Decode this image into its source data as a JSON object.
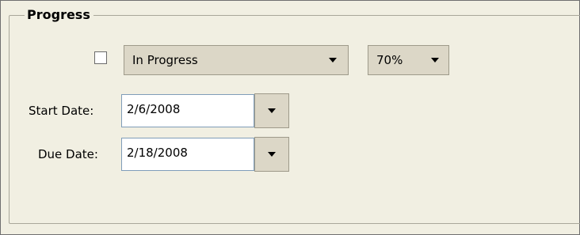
{
  "group": {
    "legend": "Progress"
  },
  "completed_checkbox": {
    "checked": false
  },
  "status": {
    "value": "In Progress"
  },
  "percent": {
    "value": "70%"
  },
  "start_date": {
    "label": "Start Date:",
    "value": "2/6/2008"
  },
  "due_date": {
    "label": "Due Date:",
    "value": "2/18/2008"
  },
  "icons": {
    "dropdown": "chevron-down-icon"
  },
  "colors": {
    "panel": "#f1efe2",
    "button_face": "#dcd7c7",
    "input_border": "#7f9db9"
  }
}
